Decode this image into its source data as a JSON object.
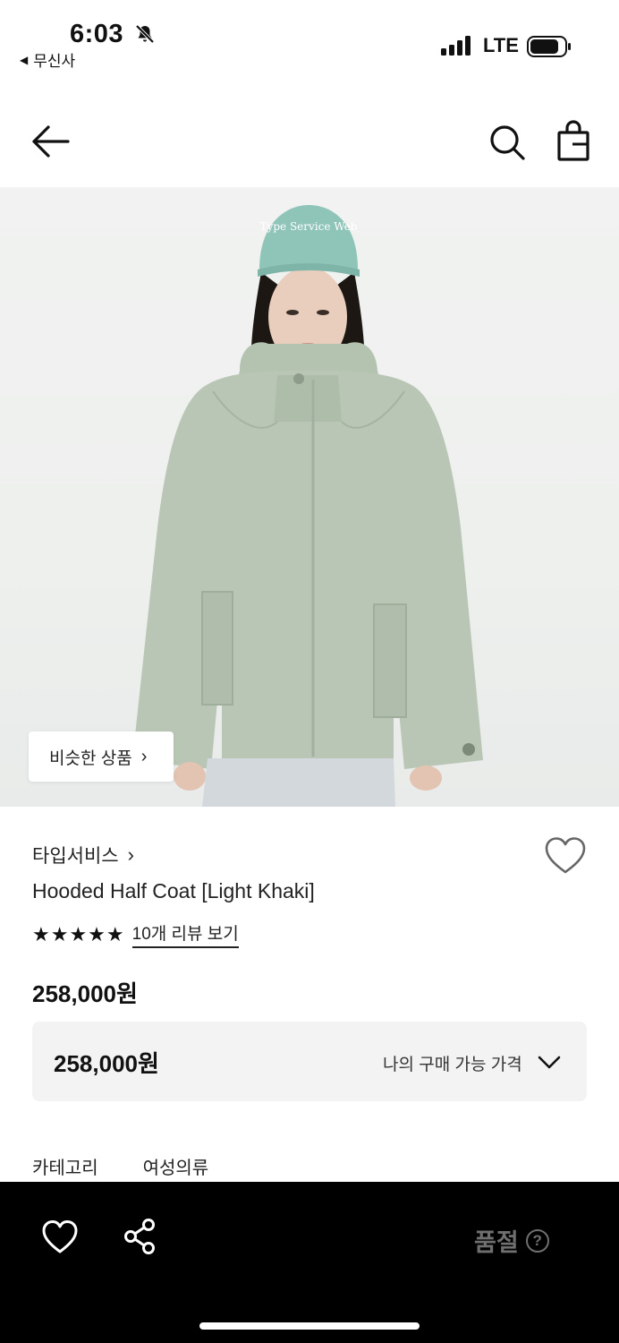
{
  "status_bar": {
    "time": "6:03",
    "back_app": "무신사",
    "network": "LTE",
    "icons": [
      "bell-muted-icon",
      "signal-icon",
      "battery-icon"
    ]
  },
  "nav": {
    "icons": [
      "back-arrow-icon",
      "search-icon",
      "shopping-bag-icon"
    ]
  },
  "image": {
    "cap_text": "Type Service Web",
    "similar_button": "비슷한 상품"
  },
  "product": {
    "brand": "타입서비스",
    "title": "Hooded Half Coat [Light Khaki]",
    "stars": "★★★★★",
    "review_link": "10개 리뷰 보기",
    "price": "258,000원"
  },
  "my_price": {
    "value": "258,000원",
    "label": "나의 구매 가능 가격"
  },
  "category": {
    "label": "카테고리",
    "value": "여성의류"
  },
  "bottom_bar": {
    "soldout_label": "품절",
    "help_glyph": "?",
    "icons": [
      "heart-outline-icon",
      "share-icon"
    ]
  },
  "colors": {
    "coat": "#b9c6b5",
    "cap": "#8fc4b8",
    "bottom_bar": "#000000",
    "soldout_text": "#6f6f6f"
  }
}
